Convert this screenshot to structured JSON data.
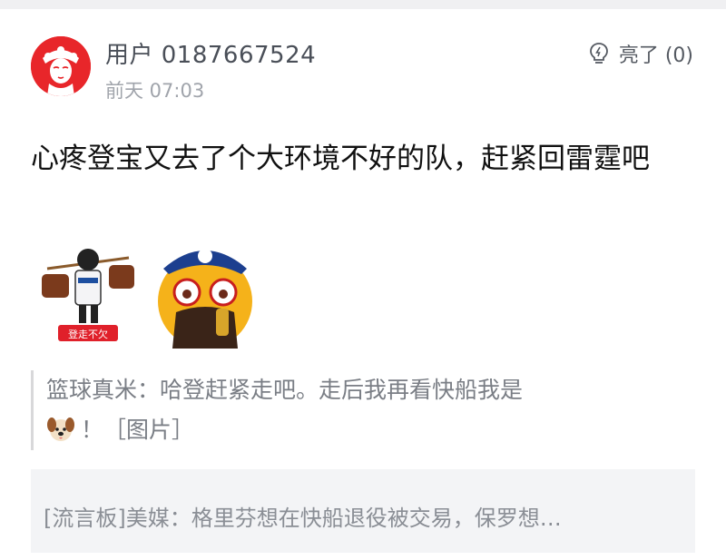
{
  "post": {
    "username": "用户 0187667524",
    "time": "前天 07:03",
    "light_label": "亮了 (0)",
    "content": "心疼登宝又去了个大环境不好的队，赶紧回雷霆吧",
    "images": [
      {
        "icon": "sticker-carrying-bags-icon",
        "caption": "登走不欠"
      },
      {
        "icon": "sticker-crying-face-icon",
        "caption": ""
      }
    ]
  },
  "quote": {
    "text": "篮球真米：哈登赶紧走吧。走后我再看快船我是",
    "emoji": "dog-face-emoji",
    "tail": "！［图片］"
  },
  "repost": {
    "text": "[流言板]美媒：格里芬想在快船退役被交易，保罗想…"
  },
  "colors": {
    "avatar_bg": "#e8262a",
    "text_main": "#111111",
    "text_muted": "#a0a4ab",
    "repost_bg": "#f3f4f6"
  }
}
